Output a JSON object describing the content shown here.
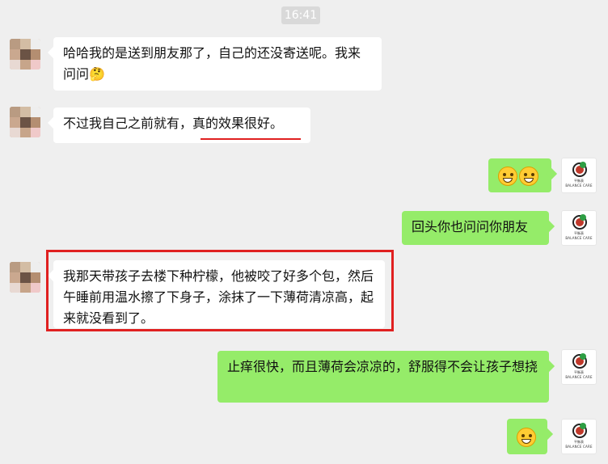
{
  "timestamp": "16:41",
  "messages": [
    {
      "side": "left",
      "text": "哈哈我的是送到朋友那了，自己的还没寄送呢。我来问问🤔"
    },
    {
      "side": "left",
      "text": "不过我自己之前就有，真的效果很好。"
    },
    {
      "side": "right",
      "emoji": "grin-emoji",
      "count": 2
    },
    {
      "side": "right",
      "text": "回头你也问问你朋友"
    },
    {
      "side": "left",
      "text": "我那天带孩子去楼下种柠檬，他被咬了好多个包，然后午睡前用温水擦了下身子，涂抹了一下薄荷清凉高，起来就没看到了。"
    },
    {
      "side": "right",
      "text": "止痒很快，而且薄荷会凉凉的，舒服得不会让孩子想挠"
    },
    {
      "side": "right",
      "emoji": "grin-emoji",
      "count": 1
    }
  ],
  "brand": {
    "cn": "平衡表",
    "en": "BALANCE CARE"
  },
  "annotations": {
    "underline_text": "真的效果很好。",
    "highlight_color": "#e02020"
  }
}
